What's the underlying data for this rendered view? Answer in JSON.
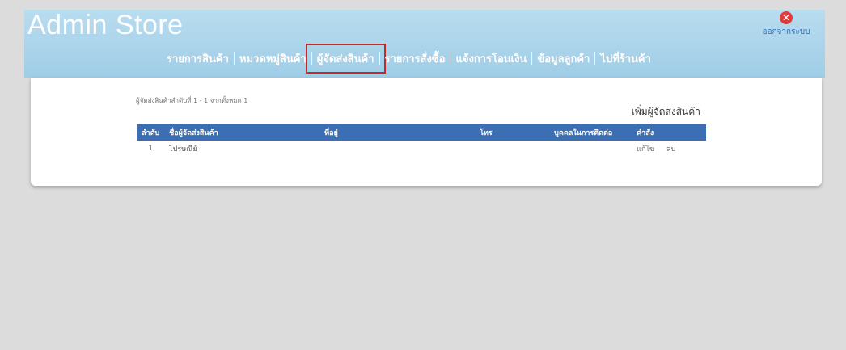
{
  "app": {
    "title": "Admin Store"
  },
  "logout": {
    "label": "ออกจากระบบ",
    "icon": "close-icon"
  },
  "nav": {
    "items": [
      {
        "label": "รายการสินค้า"
      },
      {
        "label": "หมวดหมู่สินค้า"
      },
      {
        "label": "ผู้จัดส่งสินค้า"
      },
      {
        "label": "รายการสั่งซื้อ"
      },
      {
        "label": "แจ้งการโอนเงิน"
      },
      {
        "label": "ข้อมูลลูกค้า"
      },
      {
        "label": "ไปที่ร้านค้า"
      }
    ],
    "active_index": 2
  },
  "main": {
    "summary": "ผู้จัดส่งสินค้าลำดับที่ 1 - 1 จากทั้งหมด 1",
    "add_label": "เพิ่มผู้จัดส่งสินค้า",
    "table": {
      "headers": [
        "ลำดับ",
        "ชื่อผู้จัดส่งสินค้า",
        "ที่อยู่",
        "โทร",
        "บุคคลในการติดต่อ",
        "คำสั่ง"
      ],
      "rows": [
        {
          "num": "1",
          "name": "ไปรษณีย์",
          "address": "",
          "phone": "",
          "contact": "",
          "edit": "แก้ไข",
          "delete": "ลบ"
        }
      ]
    }
  },
  "colors": {
    "accent": "#3b6eb3",
    "header_bg": "#a8d4ec",
    "highlight": "#c62828"
  }
}
